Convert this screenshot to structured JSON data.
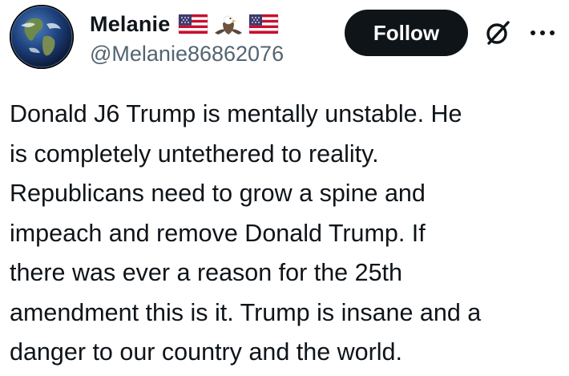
{
  "user": {
    "display_name": "Melanie",
    "name_emojis": [
      "us-flag-emoji",
      "eagle-emoji",
      "us-flag-emoji"
    ],
    "handle": "@Melanie86862076",
    "avatar": "earth-globe-avatar"
  },
  "actions": {
    "follow_label": "Follow",
    "grok_icon": "grok-slash-icon",
    "more_icon": "more-options-icon"
  },
  "tweet": {
    "lines": [
      "Donald J6 Trump is mentally unstable. He",
      "is completely untethered to reality.",
      "Republicans need to grow a spine and",
      "impeach and remove Donald Trump. If",
      "there was ever a reason for the 25th",
      "amendment this is it. Trump is insane and a",
      "danger to our country and the world."
    ]
  },
  "colors": {
    "text": "#0f1419",
    "secondary_text": "#536471",
    "follow_button_bg": "#0f1419",
    "follow_button_text": "#ffffff",
    "background": "#ffffff"
  }
}
